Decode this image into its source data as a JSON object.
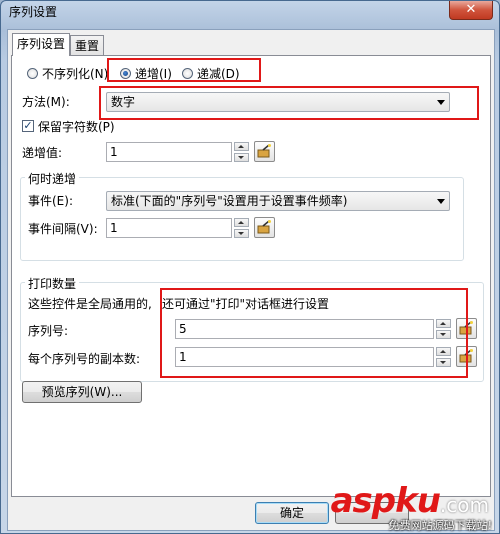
{
  "window": {
    "title": "序列设置",
    "close_glyph": "✕"
  },
  "tabs": [
    {
      "label": "序列设置",
      "active": true
    },
    {
      "label": "重置",
      "active": false
    }
  ],
  "sequence_mode": {
    "options": [
      {
        "label": "不序列化(N)",
        "selected": false
      },
      {
        "label": "递增(I)",
        "selected": true
      },
      {
        "label": "递减(D)",
        "selected": false
      }
    ]
  },
  "method": {
    "label": "方法(M):",
    "value": "数字"
  },
  "keep_digits": {
    "label": "保留字符数(P)",
    "checked": true
  },
  "increment": {
    "label": "递增值:",
    "value": "1"
  },
  "when_group": {
    "title": "何时递增",
    "event_label": "事件(E):",
    "event_value": "标准(下面的\"序列号\"设置用于设置事件频率)",
    "interval_label": "事件间隔(V):",
    "interval_value": "1"
  },
  "print_group": {
    "title": "打印数量",
    "note_prefix": "这些控件是全局通用的,",
    "note_suffix": "还可通过\"打印\"对话框进行设置",
    "serial_label": "序列号:",
    "serial_value": "5",
    "copies_label": "每个序列号的副本数:",
    "copies_value": "1"
  },
  "preview_button": "预览序列(W)...",
  "ok_button": "确定",
  "watermark": {
    "text": "aspku",
    "suffix": ".com",
    "caption": "免费网站源码下载站!"
  },
  "colors": {
    "highlight": "#e01818",
    "accent": "#3c7fb1"
  },
  "icons": {
    "close": "close-icon",
    "spinner": "spinner",
    "wizard": "magic-wand-icon"
  }
}
